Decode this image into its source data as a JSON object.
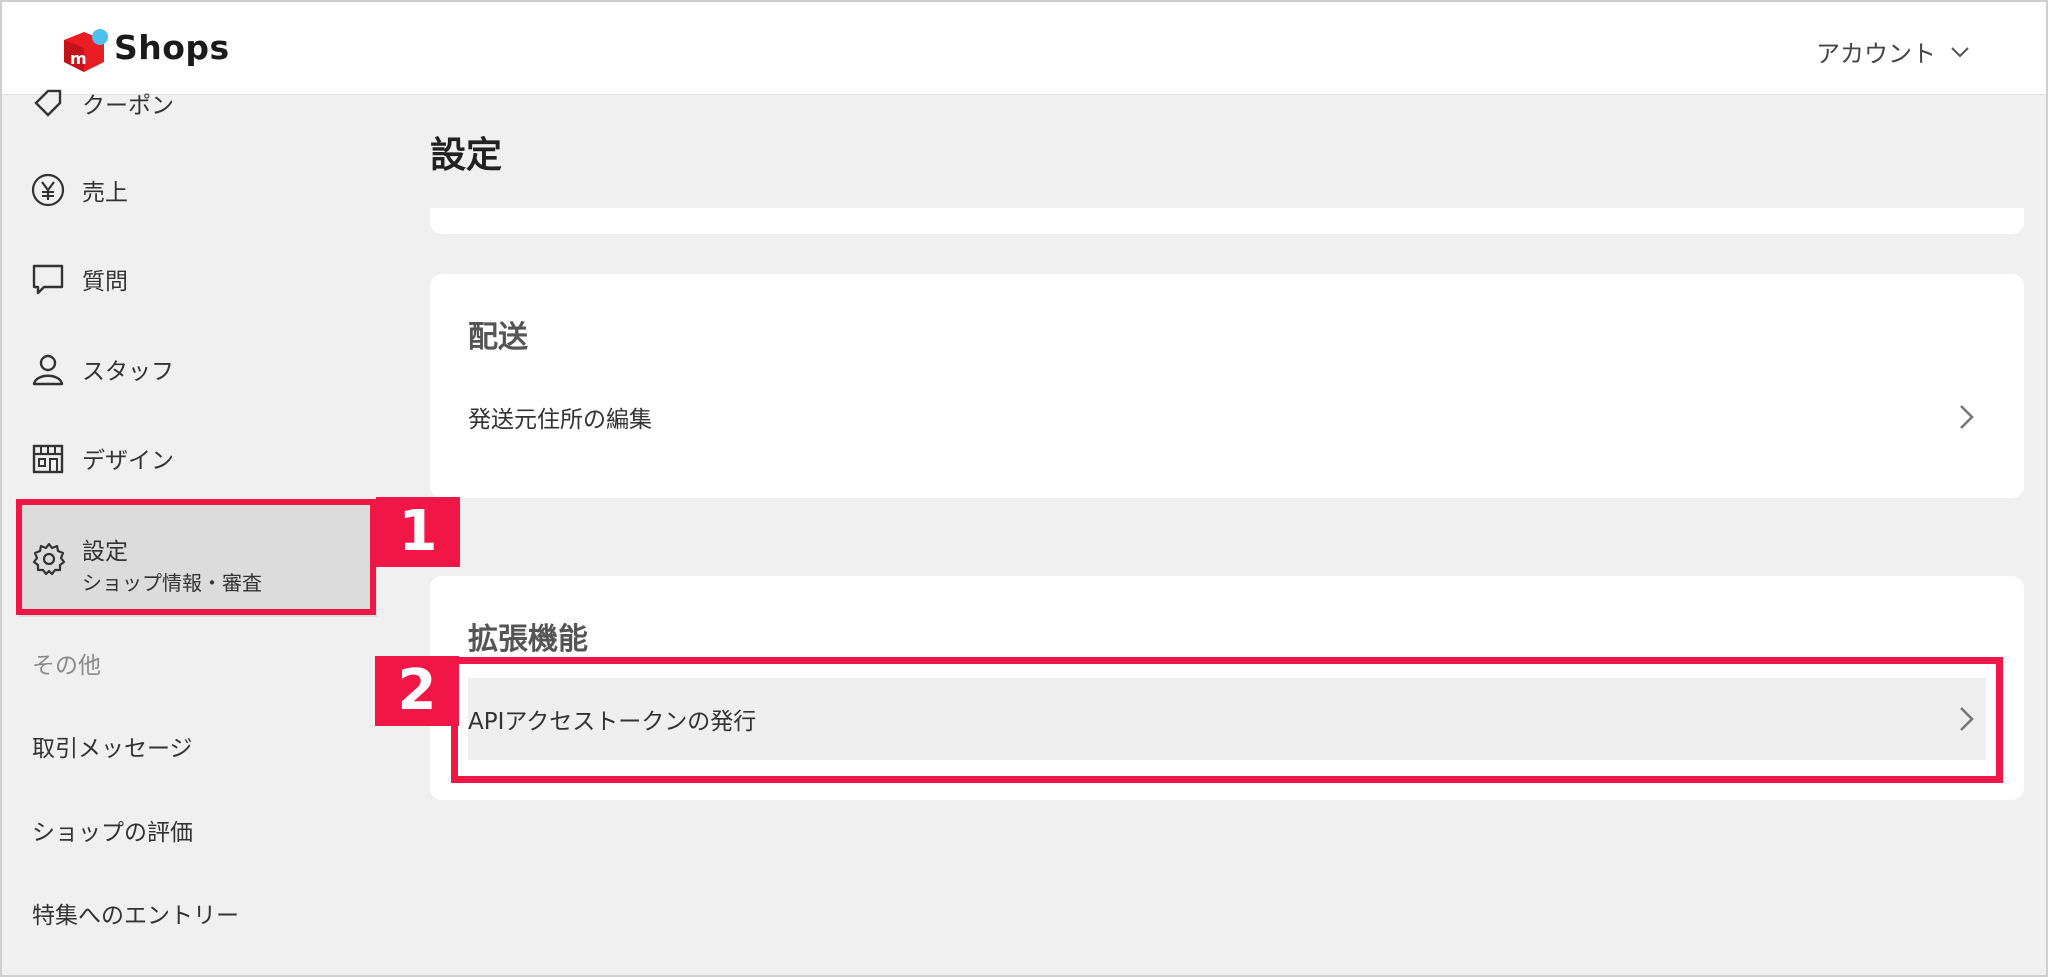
{
  "header": {
    "brand": "Shops",
    "account_label": "アカウント"
  },
  "sidebar": {
    "partial_item_label": "クーポン",
    "items": [
      {
        "label": "売上",
        "icon": "yen-icon"
      },
      {
        "label": "質問",
        "icon": "chat-bubble-icon"
      },
      {
        "label": "スタッフ",
        "icon": "person-icon"
      },
      {
        "label": "デザイン",
        "icon": "storefront-icon"
      }
    ],
    "active_item": {
      "label": "設定",
      "sub_label": "ショップ情報・審査",
      "icon": "gear-icon"
    },
    "section_other": "その他",
    "links": [
      "取引メッセージ",
      "ショップの評価",
      "特集へのエントリー"
    ]
  },
  "main": {
    "title": "設定",
    "shipping": {
      "heading": "配送",
      "row_label": "発送元住所の編集"
    },
    "extensions": {
      "heading": "拡張機能",
      "row_label": "APIアクセストークンの発行"
    }
  },
  "annotations": {
    "step1": "1",
    "step2": "2",
    "highlight_color": "#f01747"
  },
  "colors": {
    "brand_red": "#ea1c24",
    "brand_blue": "#4dc0f0",
    "background": "#f0f0f0",
    "card": "#ffffff"
  }
}
